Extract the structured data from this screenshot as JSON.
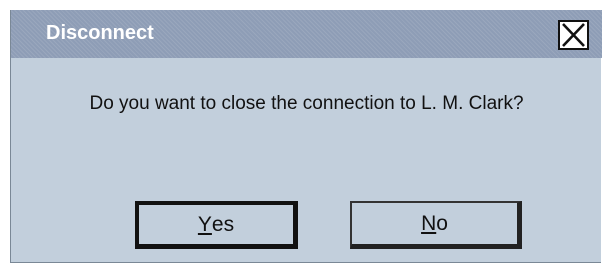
{
  "dialog": {
    "title": "Disconnect",
    "message": "Do you want to close the connection to L. M. Clark?",
    "close_icon": "close-x-icon",
    "buttons": {
      "yes": {
        "mnemonic": "Y",
        "rest": "es"
      },
      "no": {
        "mnemonic": "N",
        "rest": "o"
      }
    }
  },
  "colors": {
    "titlebar": "#8e9db6",
    "body": "#c2cfdc",
    "title_text": "#ffffff"
  }
}
